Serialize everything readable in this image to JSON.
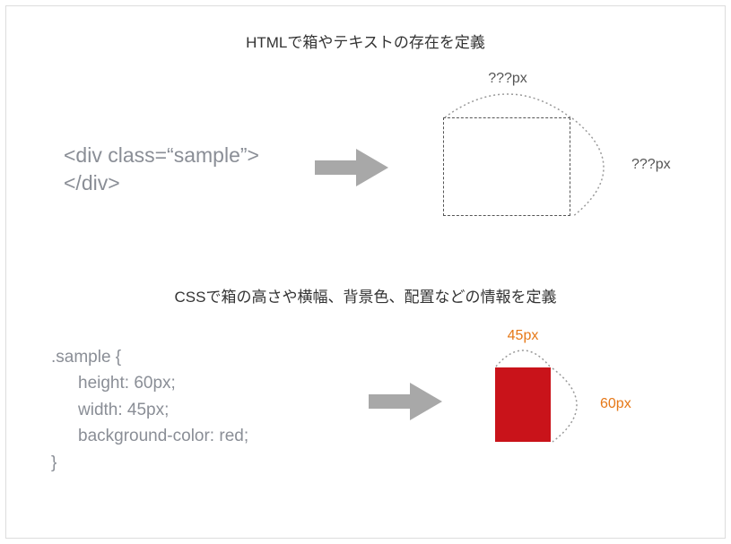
{
  "section1": {
    "title": "HTMLで箱やテキストの存在を定義",
    "code_line1": "<div class=“sample”>",
    "code_line2": "</div>",
    "width_label": "???px",
    "height_label": "???px"
  },
  "section2": {
    "title": "CSSで箱の高さや横幅、背景色、配置などの情報を定義",
    "code_line1": ".sample {",
    "code_line2": "height: 60px;",
    "code_line3": "width: 45px;",
    "code_line4": "background-color: red;",
    "code_line5": "}",
    "width_label": "45px",
    "height_label": "60px",
    "box_color": "#c9131a"
  }
}
